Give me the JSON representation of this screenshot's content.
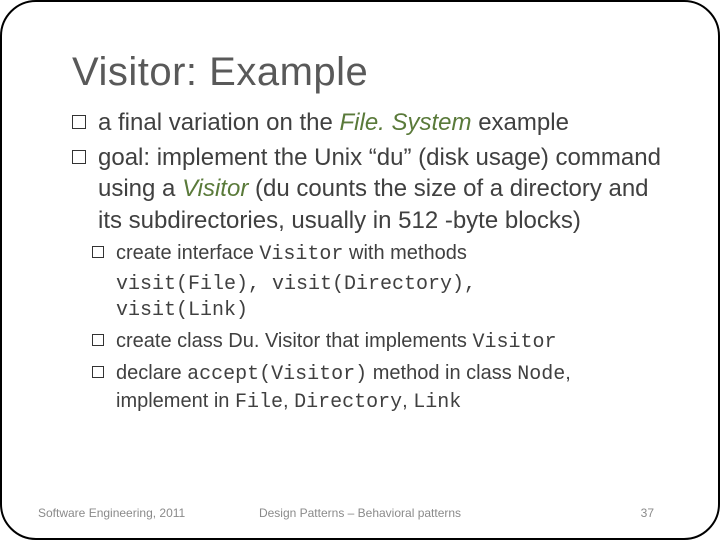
{
  "title": "Visitor: Example",
  "bullets": {
    "m1_pre": "a final variation on the ",
    "m1_em": "File. System",
    "m1_post": " example",
    "m2_pre": "goal: implement the Unix “du” (disk usage) command using a ",
    "m2_em": "Visitor",
    "m2_post": " (du counts the size of a directory and its subdirectories, usually in 512 -byte blocks)",
    "s1_a": "create interface ",
    "s1_b": "Visitor",
    "s1_c": " with methods",
    "s1_code1": "visit(File), visit(Directory),",
    "s1_code2": "visit(Link)",
    "s2_a": "create class Du. Visitor that implements ",
    "s2_b": "Visitor",
    "s3_a": "declare ",
    "s3_b": "accept(Visitor)",
    "s3_c": " method in class ",
    "s3_d": "Node",
    "s3_e": ", implement in ",
    "s3_f": "File",
    "s3_g": ", ",
    "s3_h": "Directory",
    "s3_i": ", ",
    "s3_j": "Link"
  },
  "footer": {
    "left": "Software Engineering, 2011",
    "center": "Design Patterns – Behavioral patterns",
    "right": "37"
  }
}
